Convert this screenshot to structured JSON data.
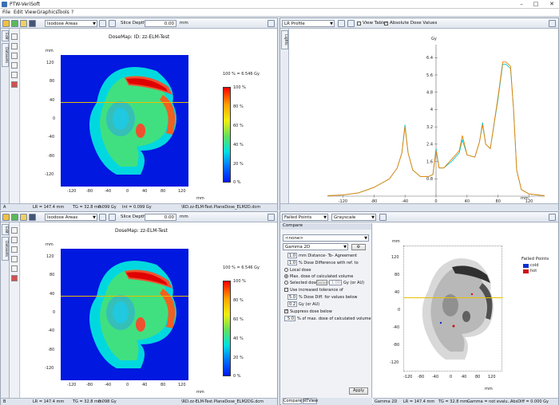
{
  "app": {
    "title": "PTW-VeriSoft"
  },
  "menu": [
    "File",
    "Edit",
    "View",
    "Graphics",
    "Tools",
    "?"
  ],
  "top_left": {
    "mode_dropdown": "Isodose Areas",
    "slice_depth_label": "Slice Depth",
    "slice_depth_value": "0.00",
    "slice_depth_unit": "mm",
    "title": "DoseMap: ID: zz-ELM-Test",
    "axis_unit": "mm",
    "legend_max": "100 % = 6.546 Gy",
    "legend_ticks": [
      "100 %",
      "80 %",
      "60 %",
      "40 %",
      "20 %",
      "0 %"
    ],
    "xticks": [
      "-120",
      "-80",
      "-40",
      "0",
      "40",
      "80",
      "120"
    ],
    "yticks": [
      "120",
      "80",
      "40",
      "0",
      "-40",
      "-80",
      "-120"
    ],
    "side_tabs": [
      "Edit",
      "Datasets"
    ],
    "status": {
      "a": "A",
      "lr": "LR = 147.4 mm",
      "tg": "TG = 32.8 mm",
      "dose": "0.099 Gy",
      "int": "Int = 0.099 Gy",
      "file": "\\RD.zz-ELM-Test.PlaneDose_ELM2D.dcm"
    }
  },
  "top_right": {
    "mode_dropdown": "LR Profile",
    "view_table": "View Table",
    "absolute_dose": "Absolute Dose Values",
    "view_table_checked": false,
    "absolute_dose_checked": true,
    "side_tab": "Lights",
    "y_unit": "Gy",
    "x_unit": "mm",
    "yticks": [
      "6.4",
      "5.6",
      "4.8",
      "4",
      "3.2",
      "2.4",
      "1.6",
      "0.8"
    ],
    "xticks": [
      "-120",
      "-80",
      "-40",
      "0",
      "40",
      "80",
      "120"
    ]
  },
  "bottom_left": {
    "mode_dropdown": "Isodose Areas",
    "slice_depth_label": "Slice Depth",
    "slice_depth_value": "0.00",
    "slice_depth_unit": "mm",
    "title": "DoseMap: zz-ELM-Test",
    "axis_unit": "mm",
    "legend_max": "100 % = 6.546 Gy",
    "legend_ticks": [
      "100 %",
      "80 %",
      "60 %",
      "40 %",
      "20 %",
      "0 %"
    ],
    "xticks": [
      "-120",
      "-80",
      "-40",
      "0",
      "40",
      "80",
      "120"
    ],
    "yticks": [
      "120",
      "80",
      "40",
      "0",
      "-40",
      "-80",
      "-120"
    ],
    "side_tabs": [
      "Edit",
      "Datasets"
    ],
    "status": {
      "a": "B",
      "lr": "LR = 147.4 mm",
      "tg": "TG = 32.8 mm",
      "dose": "0.098 Gy",
      "file": "\\RD.zz-ELM-Test.PlaneDose_ELM2DG.dcm"
    }
  },
  "bottom_right": {
    "mode_dropdown": "Failed Points",
    "color_dropdown": "Grayscale",
    "compare_header": "Compare",
    "preset_dropdown": "<none>",
    "method_dropdown": "Gamma 2D",
    "dta_value": "1.0",
    "dta_label": "mm Distance- To- Agreement",
    "dd_value": "1.0",
    "dd_label": "% Dose Difference with ref. to",
    "local_dose": "Local dose",
    "max_dose": "Max. dose of calculated volume",
    "selected_dose": "Selected dose",
    "selected_dose_value": "1.00",
    "selected_dose_unit": "Gy (or AU)",
    "select_btn": "Select",
    "increased_tol": "Use increased tolerance of",
    "inc_dd_value": "5.0",
    "inc_dd_label": "% Dose Diff. for values below",
    "inc_gy_value": "0.2",
    "inc_gy_label": "Gy (or AU)",
    "suppress": "Suppress dose below",
    "suppress_value": "5.0",
    "suppress_label": "% of max. dose of calculated volume",
    "apply": "Apply",
    "tabs": [
      "Compare",
      "RTView"
    ],
    "failed_title": "Failed Points",
    "legend_cold": "cold",
    "legend_hot": "hot",
    "color_cold": "#1030d0",
    "color_hot": "#d01010",
    "axis_unit": "mm",
    "xticks": [
      "-120",
      "-80",
      "-40",
      "0",
      "40",
      "80",
      "120"
    ],
    "yticks": [
      "120",
      "80",
      "40",
      "0",
      "-40",
      "-80",
      "-120"
    ],
    "status": {
      "mode": "Gamma 2D",
      "lr": "LR = 147.4 mm",
      "tg": "TG = 32.8 mm",
      "gamma": "Gamma = not evalu...",
      "absdiff": "AbsDiff = 0.000 Gy"
    }
  },
  "chart_data": {
    "type": "line",
    "title": "",
    "xlabel": "mm",
    "ylabel": "Gy",
    "xlim": [
      -140,
      140
    ],
    "ylim": [
      0,
      7
    ],
    "series": [
      {
        "name": "",
        "color": "#00c8c8",
        "x": [
          -140,
          -120,
          -100,
          -80,
          -60,
          -50,
          -44,
          -40,
          -36,
          -30,
          -20,
          -10,
          -4,
          0,
          4,
          10,
          20,
          30,
          34,
          40,
          50,
          56,
          60,
          64,
          70,
          80,
          86,
          90,
          96,
          100,
          104,
          110,
          120,
          140
        ],
        "y": [
          0.02,
          0.05,
          0.15,
          0.4,
          0.8,
          1.3,
          2.0,
          3.3,
          2.0,
          1.2,
          0.9,
          0.9,
          1.0,
          2.2,
          1.3,
          1.3,
          1.6,
          2.0,
          2.6,
          1.9,
          1.8,
          2.5,
          3.4,
          2.4,
          2.2,
          4.5,
          6.1,
          6.1,
          5.9,
          4.0,
          1.2,
          0.3,
          0.1,
          0.02
        ]
      },
      {
        "name": "",
        "color": "#f08000",
        "x": [
          -140,
          -120,
          -100,
          -80,
          -60,
          -50,
          -44,
          -40,
          -36,
          -30,
          -20,
          -10,
          -4,
          0,
          4,
          10,
          20,
          30,
          34,
          40,
          50,
          56,
          60,
          64,
          70,
          80,
          86,
          90,
          96,
          100,
          104,
          110,
          120,
          140
        ],
        "y": [
          0.02,
          0.05,
          0.15,
          0.4,
          0.8,
          1.3,
          2.0,
          3.2,
          2.0,
          1.2,
          0.9,
          0.9,
          1.0,
          2.1,
          1.3,
          1.3,
          1.7,
          2.1,
          2.8,
          1.9,
          1.8,
          2.5,
          3.3,
          2.4,
          2.2,
          4.6,
          6.2,
          6.2,
          6.0,
          4.0,
          1.2,
          0.3,
          0.1,
          0.02
        ]
      }
    ]
  }
}
